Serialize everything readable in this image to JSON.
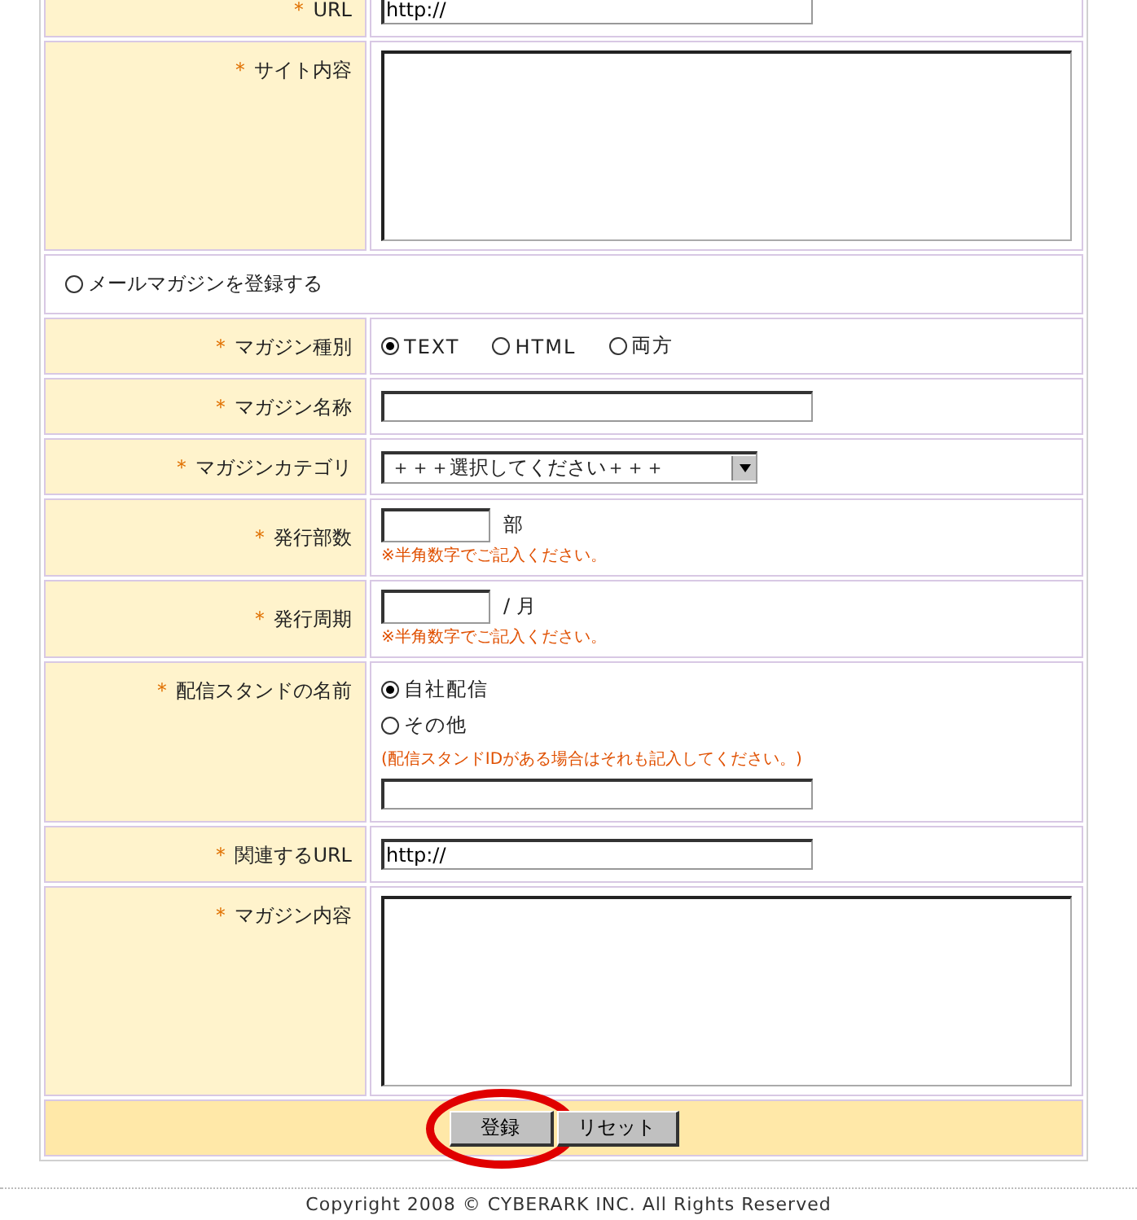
{
  "rows": [
    {
      "kind": "text",
      "mark": "＊",
      "label": "URL",
      "value": "http://"
    },
    {
      "kind": "textarea",
      "mark": "＊",
      "label": "サイト内容"
    },
    {
      "kind": "option",
      "label": "メールマガジンを登録する",
      "checked": false
    },
    {
      "kind": "radio",
      "mark": "＊",
      "label": "マガジン種別",
      "options": [
        {
          "label": "TEXT",
          "selected": true
        },
        {
          "label": "HTML",
          "selected": false
        },
        {
          "label": "両方",
          "selected": false
        }
      ]
    },
    {
      "kind": "text",
      "mark": "＊",
      "label": "マガジン名称",
      "value": ""
    },
    {
      "kind": "select",
      "mark": "＊",
      "label": "マガジンカテゴリ",
      "value": "＋＋＋選択してください＋＋＋"
    },
    {
      "kind": "number",
      "mark": "＊",
      "label": "発行部数",
      "unit": "部",
      "note": "※半角数字でご記入ください。"
    },
    {
      "kind": "number",
      "mark": "＊",
      "label": "発行周期",
      "unit": "/ 月",
      "note": "※半角数字でご記入ください。"
    },
    {
      "kind": "radiolist",
      "mark": "＊",
      "label": "配信スタンドの名前",
      "options": [
        {
          "label": "自社配信",
          "selected": true
        },
        {
          "label": "その他",
          "selected": false
        }
      ],
      "note": "(配信スタンドIDがある場合はそれも記入してください。)"
    },
    {
      "kind": "text",
      "mark": "＊",
      "label": "関連するURL",
      "value": "http://"
    },
    {
      "kind": "textarea",
      "mark": "＊",
      "label": "マガジン内容"
    }
  ],
  "buttons": [
    {
      "label": "登録",
      "circled": true
    },
    {
      "label": "リセット",
      "circled": false
    }
  ],
  "copyright": "Copyright 2008 © CYBERARK INC. All Rights Reserved"
}
